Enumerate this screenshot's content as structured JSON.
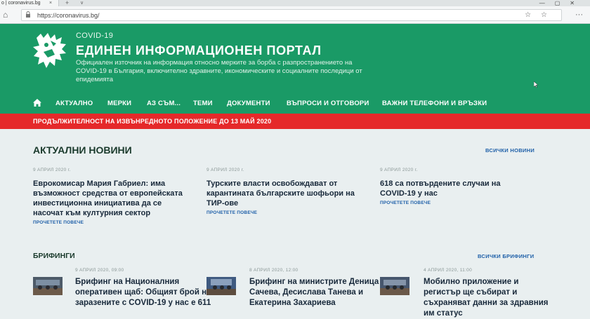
{
  "browser": {
    "tab_title": "o | coronavirus.bg",
    "tab_close": "×",
    "tab_new": "+",
    "tab_menu": "∨",
    "window_controls": "—▢✕",
    "url": "https://coronavirus.bg/",
    "url_actions": "☆☆",
    "menu": "···",
    "back": "←",
    "forward": "→",
    "reload": "↻",
    "home": "⌂"
  },
  "site": {
    "kicker": "COVID-19",
    "title": "ЕДИНЕН ИНФОРМАЦИОНЕН ПОРТАЛ",
    "subtitle": "Официален източник на информация относно мерките за борба с разпространението на COVID-19 в България, включително здравните, икономическите и социалните последици от епидемията",
    "brand_color": "#1a9a66",
    "alert_color": "#e5292a"
  },
  "nav": {
    "items": [
      "АКТУАЛНО",
      "МЕРКИ",
      "АЗ СЪМ...",
      "ТЕМИ",
      "ДОКУМЕНТИ",
      "ВЪПРОСИ И ОТГОВОРИ",
      "ВАЖНИ ТЕЛЕФОНИ И ВРЪЗКИ"
    ]
  },
  "alert": {
    "text": "ПРОДЪЛЖИТЕЛНОСТ НА ИЗВЪНРЕДНОТО ПОЛОЖЕНИЕ ДО 13 МАЙ 2020"
  },
  "news": {
    "title": "АКТУАЛНИ НОВИНИ",
    "all_link": "ВСИЧКИ НОВИНИ",
    "items": [
      {
        "date": "9 АПРИЛ 2020 г.",
        "title": "Еврокомисар Мария Габриел: има възможност средства от европейската инвестиционна инициатива да се насочат към културния сектор",
        "more": "ПРОЧЕТЕТЕ ПОВЕЧЕ"
      },
      {
        "date": "9 АПРИЛ 2020 г.",
        "title": "Турските власти освобождават от карантината българските шофьори на ТИР-ове",
        "more": "ПРОЧЕТЕТЕ ПОВЕЧЕ"
      },
      {
        "date": "9 АПРИЛ 2020 г.",
        "title": "618 са потвърдените случаи на COVID-19 у нас",
        "more": "ПРОЧЕТЕТЕ ПОВЕЧЕ"
      }
    ]
  },
  "briefings": {
    "title": "БРИФИНГИ",
    "all_link": "ВСИЧКИ БРИФИНГИ",
    "items": [
      {
        "date": "9 АПРИЛ 2020, 09:00",
        "title": "Брифинг на Националния оперативен щаб: Общият брой на заразените с COVID-19 у нас е 611"
      },
      {
        "date": "8 АПРИЛ 2020, 12:00",
        "title": "Брифинг на министрите Деница Сачева, Десислава Танева и Екатерина Захариева"
      },
      {
        "date": "4 АПРИЛ 2020, 11:00",
        "title": "Мобилно приложение и регистър ще събират и съхраняват данни за здравния им статус"
      }
    ]
  }
}
